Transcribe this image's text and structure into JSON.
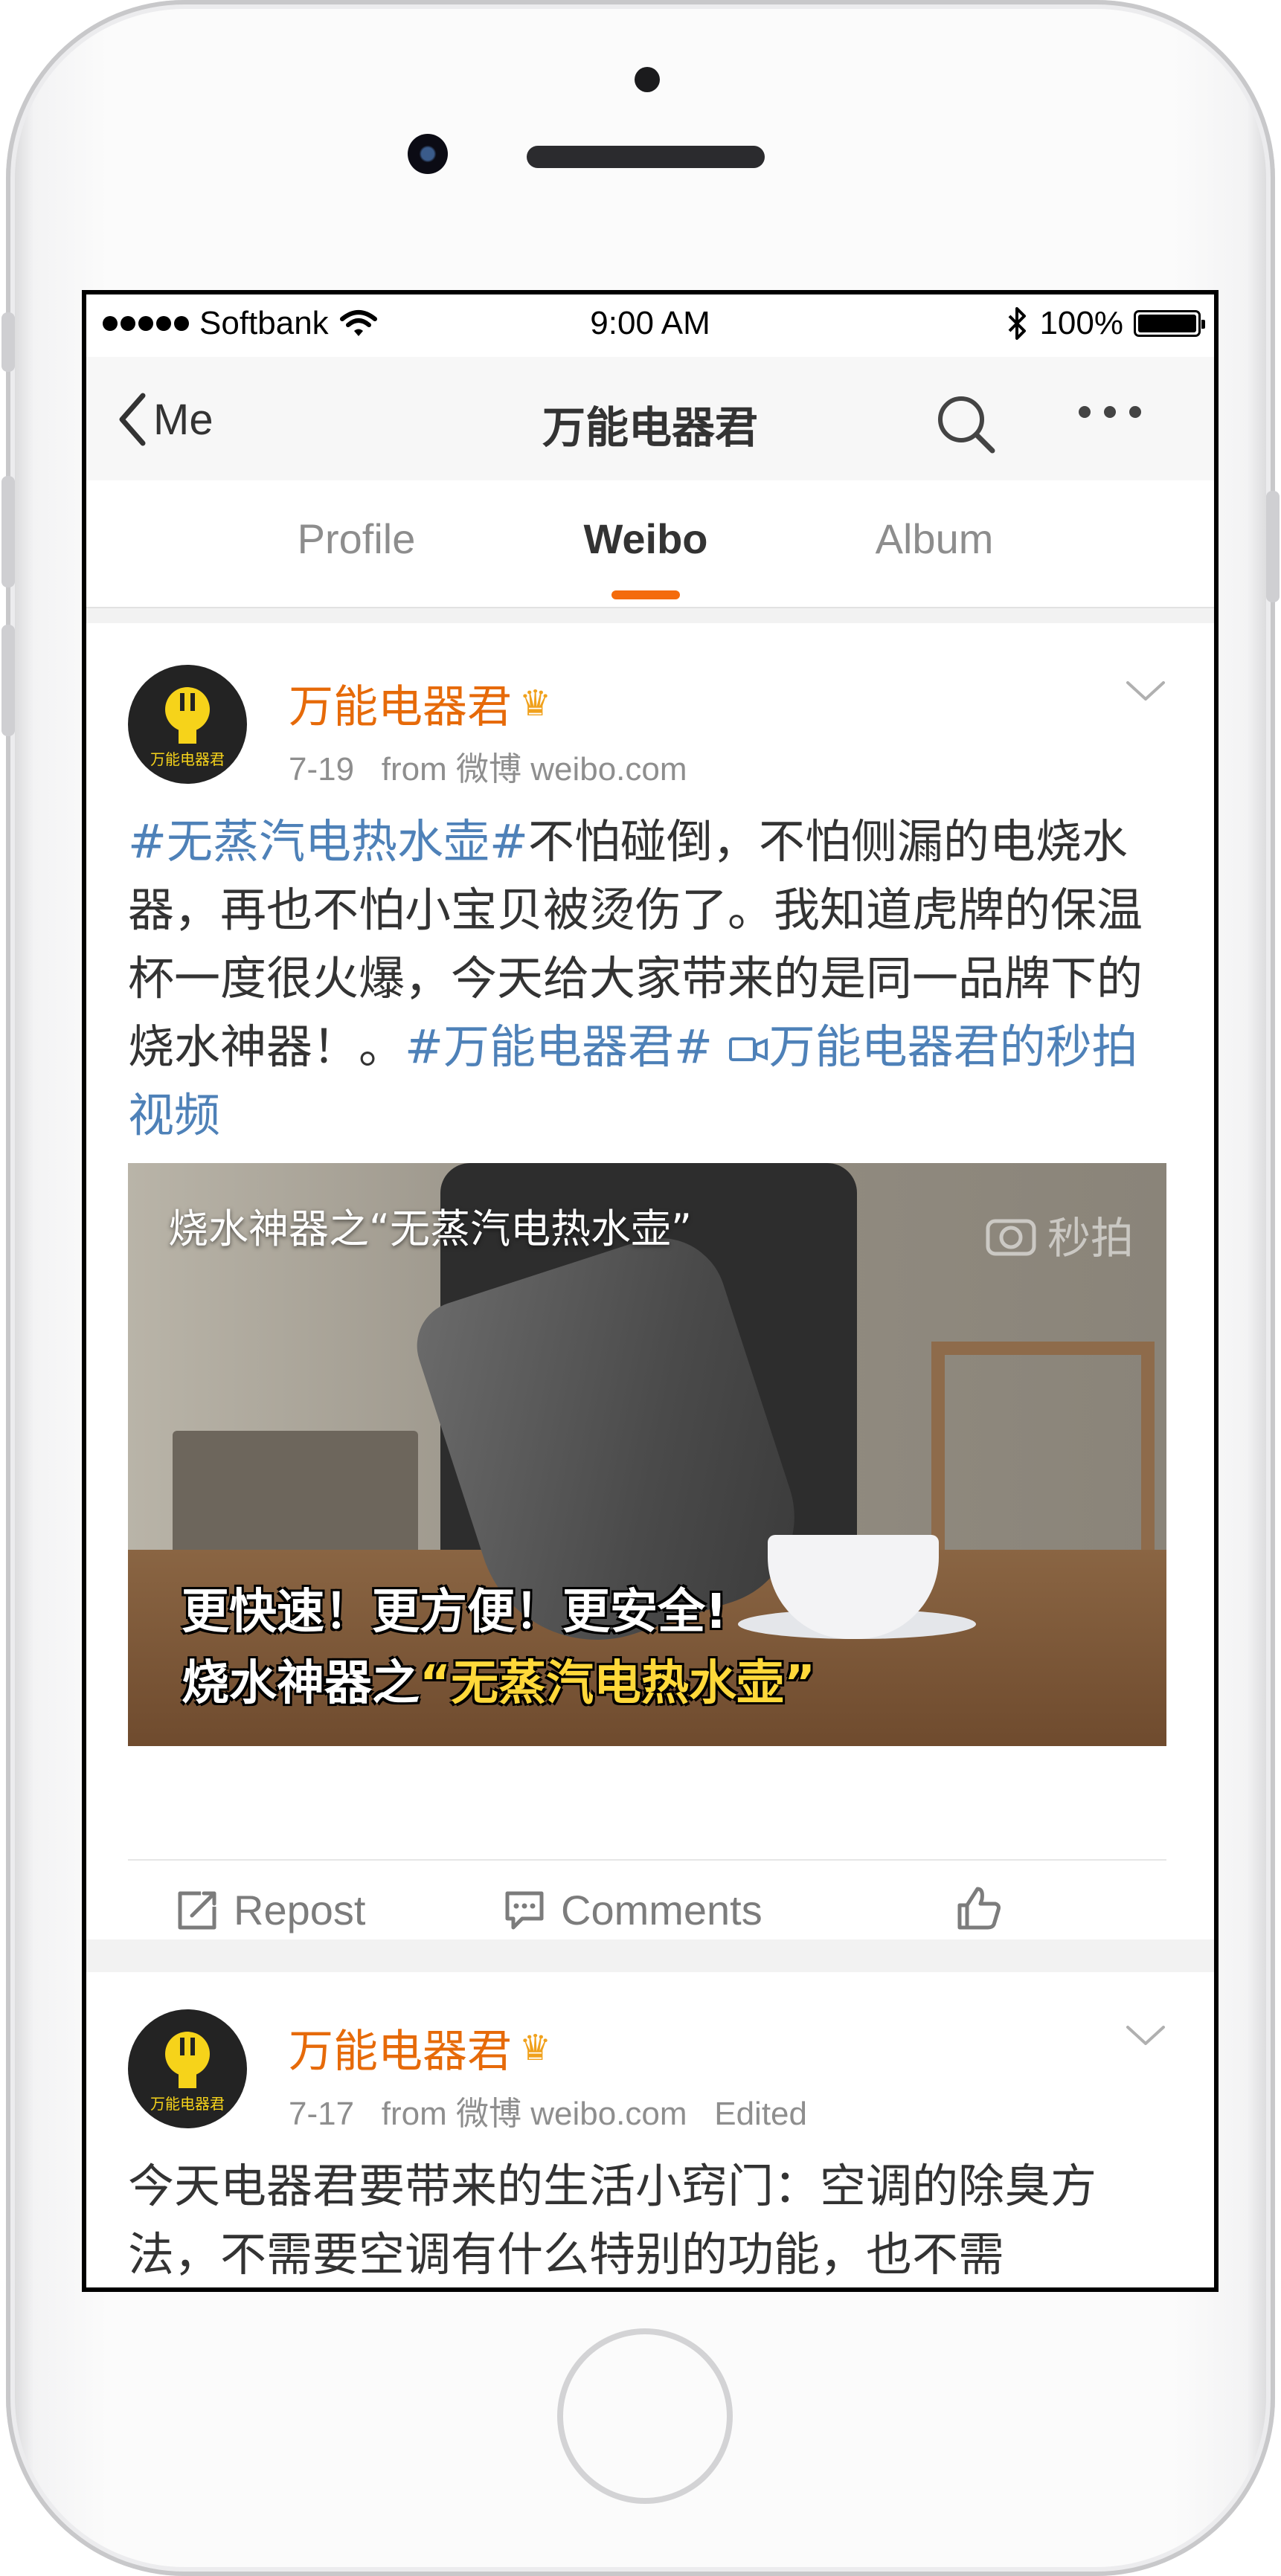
{
  "device": {
    "carrier": "Softbank",
    "time": "9:00 AM",
    "battery": "100%"
  },
  "navbar": {
    "back_label": "Me",
    "title": "万能电器君"
  },
  "tabs": [
    {
      "label": "Profile",
      "active": false
    },
    {
      "label": "Weibo",
      "active": true
    },
    {
      "label": "Album",
      "active": false
    }
  ],
  "posts": [
    {
      "author": "万能电器君",
      "date": "7-19",
      "source": "from 微博 weibo.com",
      "edited": "",
      "text": {
        "hashtag1": "#无蒸汽电热水壶#",
        "body": "不怕碰倒，不怕侧漏的电烧水器，再也不怕小宝贝被烫伤了。我知道虎牌的保温杯一度很火爆，今天给大家带来的是同一品牌下的烧水神器！。",
        "hashtag2": "#万能电器君#",
        "link": "万能电器君的秒拍视频"
      },
      "video": {
        "title": "烧水神器之“无蒸汽电热水壶”",
        "watermark": "秒拍",
        "caption_line1": "更快速！更方便！更安全!",
        "caption_line2_prefix": "烧水神器之",
        "caption_line2_highlight": "“无蒸汽电热水壶”"
      },
      "actions": {
        "repost": "Repost",
        "comments": "Comments"
      }
    },
    {
      "author": "万能电器君",
      "date": "7-17",
      "source": "from 微博 weibo.com",
      "edited": "Edited",
      "text_preview": "今天电器君要带来的生活小窍门：空调的除臭方法，不需要空调有什么特别的功能，也不需"
    }
  ],
  "colors": {
    "accent": "#f46b0c",
    "author": "#e66a09",
    "link": "#4e81b8"
  },
  "avatar_label": "万能电器君"
}
